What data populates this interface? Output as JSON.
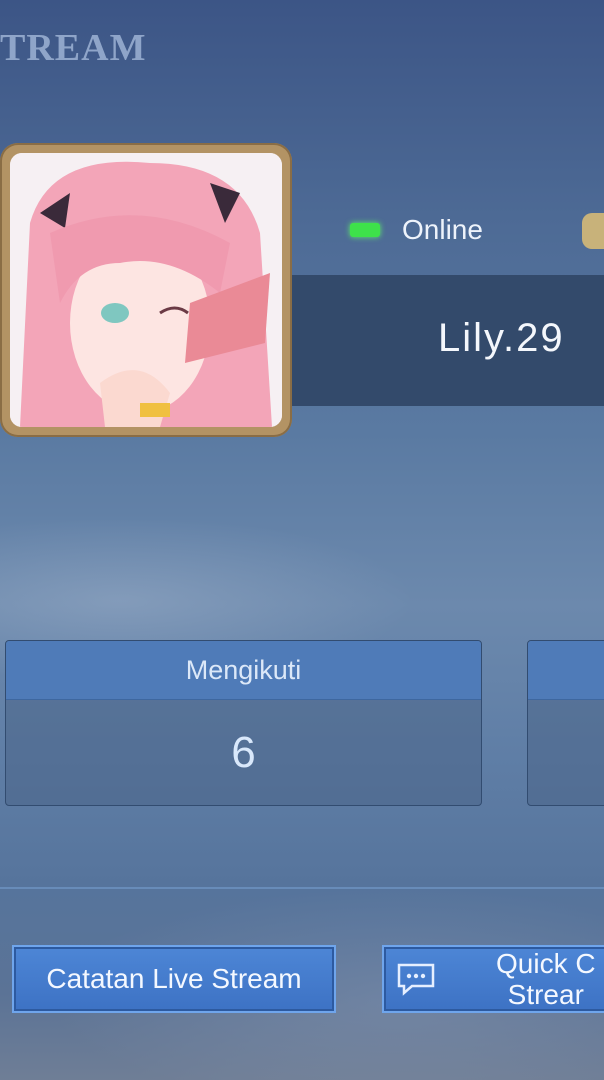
{
  "header": {
    "title": "TREAM"
  },
  "profile": {
    "avatar_icon": "anime-girl-avatar",
    "status": "Online",
    "status_color": "#3ee24a",
    "name": "Lily.29"
  },
  "stats": [
    {
      "label": "Mengikuti",
      "value": "6"
    },
    {
      "label": "",
      "value": ""
    }
  ],
  "buttons": {
    "record_label": "Catatan Live Stream",
    "quick_label": "Quick C\nStrear"
  },
  "colors": {
    "accent": "#4f7bb8",
    "button": "#3d72c4",
    "frame": "#b39364"
  }
}
